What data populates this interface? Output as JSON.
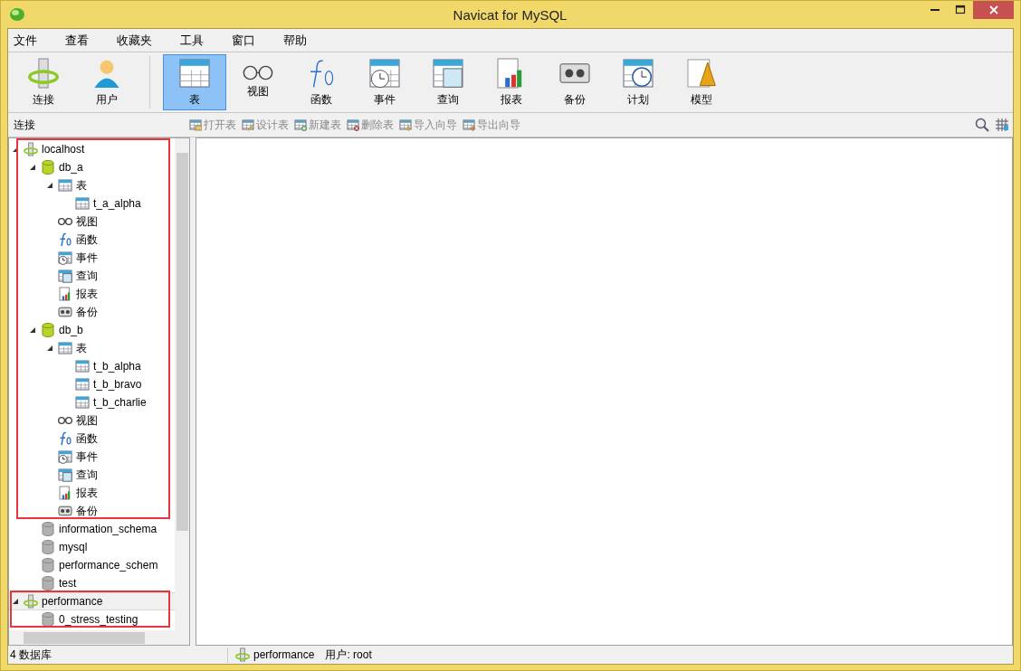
{
  "window": {
    "title": "Navicat for MySQL"
  },
  "menu": [
    "文件",
    "查看",
    "收藏夹",
    "工具",
    "窗口",
    "帮助"
  ],
  "toolbar": {
    "groups": [
      [
        {
          "kind": "connection",
          "label": "连接",
          "selected": false
        },
        {
          "kind": "user",
          "label": "用户",
          "selected": false
        }
      ],
      [
        {
          "kind": "table",
          "label": "表",
          "selected": true
        },
        {
          "kind": "view",
          "label": "视图",
          "selected": false
        },
        {
          "kind": "function",
          "label": "函数",
          "selected": false
        },
        {
          "kind": "event",
          "label": "事件",
          "selected": false
        },
        {
          "kind": "query",
          "label": "查询",
          "selected": false
        },
        {
          "kind": "report",
          "label": "报表",
          "selected": false
        },
        {
          "kind": "backup",
          "label": "备份",
          "selected": false
        },
        {
          "kind": "schedule",
          "label": "计划",
          "selected": false
        },
        {
          "kind": "model",
          "label": "模型",
          "selected": false
        }
      ]
    ]
  },
  "sidebar": {
    "title": "连接"
  },
  "actions": [
    {
      "kind": "open",
      "label": "打开表",
      "disabled": true
    },
    {
      "kind": "design",
      "label": "设计表",
      "disabled": true
    },
    {
      "kind": "new",
      "label": "新建表",
      "disabled": true
    },
    {
      "kind": "delete",
      "label": "删除表",
      "disabled": true
    },
    {
      "kind": "import",
      "label": "导入向导",
      "disabled": true
    },
    {
      "kind": "export",
      "label": "导出向导",
      "disabled": true
    }
  ],
  "tree": [
    {
      "kind": "connection",
      "label": "localhost",
      "expanded": true,
      "selected": false,
      "boxed": true,
      "children": [
        {
          "kind": "database",
          "label": "db_a",
          "expanded": true,
          "selected": false,
          "boxed": true,
          "children": [
            {
              "kind": "tables",
              "label": "表",
              "expanded": true,
              "selected": false,
              "boxed": true,
              "children": [
                {
                  "kind": "table",
                  "label": "t_a_alpha",
                  "selected": false,
                  "boxed": true
                }
              ]
            },
            {
              "kind": "view",
              "label": "视图",
              "selected": false,
              "boxed": true
            },
            {
              "kind": "function",
              "label": "函数",
              "selected": false,
              "boxed": true
            },
            {
              "kind": "event",
              "label": "事件",
              "selected": false,
              "boxed": true
            },
            {
              "kind": "query",
              "label": "查询",
              "selected": false,
              "boxed": true
            },
            {
              "kind": "report",
              "label": "报表",
              "selected": false,
              "boxed": true
            },
            {
              "kind": "backup",
              "label": "备份",
              "selected": false,
              "boxed": true
            }
          ]
        },
        {
          "kind": "database",
          "label": "db_b",
          "expanded": true,
          "selected": false,
          "boxed": true,
          "children": [
            {
              "kind": "tables",
              "label": "表",
              "expanded": true,
              "selected": false,
              "boxed": true,
              "children": [
                {
                  "kind": "table",
                  "label": "t_b_alpha",
                  "selected": false,
                  "boxed": true
                },
                {
                  "kind": "table",
                  "label": "t_b_bravo",
                  "selected": false,
                  "boxed": true
                },
                {
                  "kind": "table",
                  "label": "t_b_charlie",
                  "selected": false,
                  "boxed": true
                }
              ]
            },
            {
              "kind": "view",
              "label": "视图",
              "selected": false,
              "boxed": true
            },
            {
              "kind": "function",
              "label": "函数",
              "selected": false,
              "boxed": true
            },
            {
              "kind": "event",
              "label": "事件",
              "selected": false,
              "boxed": true
            },
            {
              "kind": "query",
              "label": "查询",
              "selected": false,
              "boxed": true
            },
            {
              "kind": "report",
              "label": "报表",
              "selected": false,
              "boxed": true
            },
            {
              "kind": "backup",
              "label": "备份",
              "selected": false,
              "boxed": true
            }
          ]
        },
        {
          "kind": "database",
          "label": "information_schema",
          "expanded": false,
          "selected": false,
          "boxed": false
        },
        {
          "kind": "database",
          "label": "mysql",
          "expanded": false,
          "selected": false,
          "boxed": false
        },
        {
          "kind": "database",
          "label": "performance_schem",
          "expanded": false,
          "selected": false,
          "boxed": false
        },
        {
          "kind": "database",
          "label": "test",
          "expanded": false,
          "selected": false,
          "boxed": false
        }
      ]
    },
    {
      "kind": "connection",
      "label": "performance",
      "expanded": true,
      "selected": true,
      "boxed": true,
      "children": [
        {
          "kind": "database",
          "label": "0_stress_testing",
          "expanded": false,
          "selected": false,
          "boxed": true
        }
      ]
    }
  ],
  "status_bar": {
    "count": "4 数据库",
    "connection": "performance",
    "user": "用户: root"
  }
}
